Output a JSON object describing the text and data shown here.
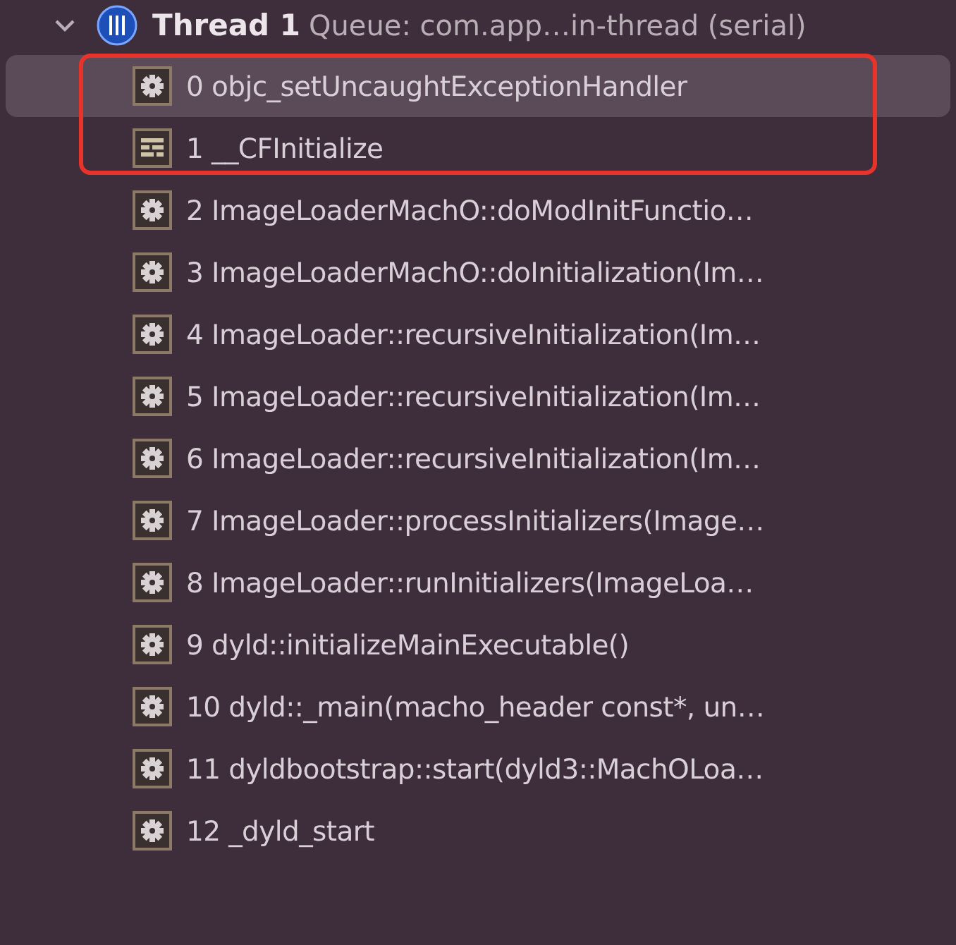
{
  "thread": {
    "expanded": true,
    "title": "Thread 1",
    "queue": "Queue: com.app…in-thread (serial)"
  },
  "frames": [
    {
      "kind": "gear",
      "label": "0 objc_setUncaughtExceptionHandler",
      "selected": true
    },
    {
      "kind": "table",
      "label": "1 __CFInitialize",
      "selected": false
    },
    {
      "kind": "gear",
      "label": "2 ImageLoaderMachO::doModInitFunctio…",
      "selected": false
    },
    {
      "kind": "gear",
      "label": "3 ImageLoaderMachO::doInitialization(Im…",
      "selected": false
    },
    {
      "kind": "gear",
      "label": "4 ImageLoader::recursiveInitialization(Im…",
      "selected": false
    },
    {
      "kind": "gear",
      "label": "5 ImageLoader::recursiveInitialization(Im…",
      "selected": false
    },
    {
      "kind": "gear",
      "label": "6 ImageLoader::recursiveInitialization(Im…",
      "selected": false
    },
    {
      "kind": "gear",
      "label": "7 ImageLoader::processInitializers(Image…",
      "selected": false
    },
    {
      "kind": "gear",
      "label": "8 ImageLoader::runInitializers(ImageLoa…",
      "selected": false
    },
    {
      "kind": "gear",
      "label": "9 dyld::initializeMainExecutable()",
      "selected": false
    },
    {
      "kind": "gear",
      "label": "10 dyld::_main(macho_header const*, un…",
      "selected": false
    },
    {
      "kind": "gear",
      "label": "11 dyldbootstrap::start(dyld3::MachOLoa…",
      "selected": false
    },
    {
      "kind": "gear",
      "label": "12 _dyld_start",
      "selected": false
    }
  ],
  "annotation": {
    "kind": "highlight-box"
  }
}
